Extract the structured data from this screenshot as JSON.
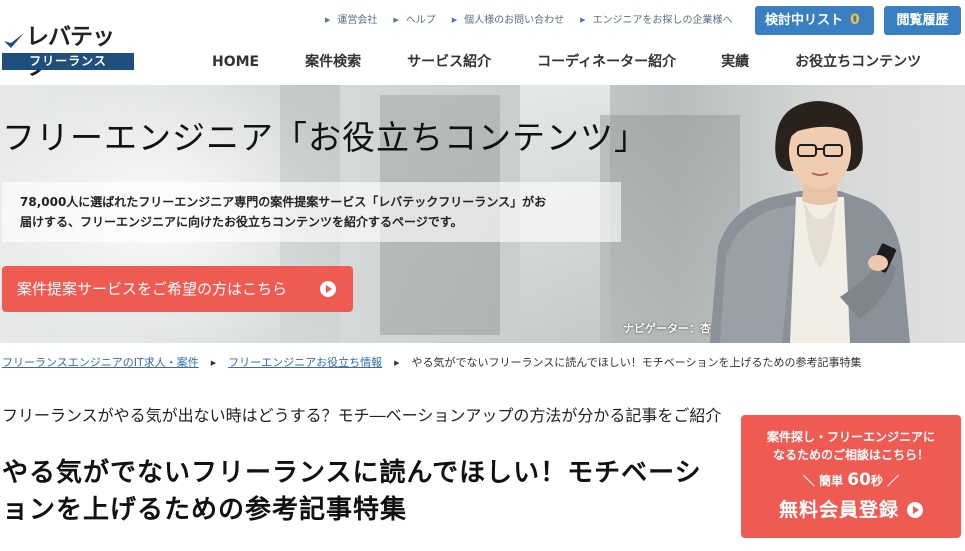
{
  "logo": {
    "main": "レバテック",
    "sub": "フリーランス"
  },
  "util_links": [
    "運営会社",
    "ヘルプ",
    "個人様のお問い合わせ",
    "エンジニアをお探しの企業様へ"
  ],
  "header_buttons": {
    "list_label": "検討中リスト",
    "list_count": "0",
    "history_label": "閲覧履歴"
  },
  "gnav": [
    "HOME",
    "案件検索",
    "サービス紹介",
    "コーディネーター紹介",
    "実績",
    "お役立ちコンテンツ"
  ],
  "hero": {
    "title": "フリーエンジニア「お役立ちコンテンツ」",
    "desc_line1": "78,000人に選ばれたフリーエンジニア専門の案件提案サービス「レバテックフリーランス」がお",
    "desc_line2": "届けする、フリーエンジニアに向けたお役立ちコンテンツを紹介するページです。",
    "cta": "案件提案サービスをご希望の方はこちら",
    "navigator": "ナビゲーター：杏"
  },
  "breadcrumb": {
    "items": [
      "フリーランスエンジニアのIT求人・案件",
      "フリーエンジニアお役立ち情報"
    ],
    "current": "やる気がでないフリーランスに読んでほしい！モチベーションを上げるための参考記事特集"
  },
  "article": {
    "lead": "フリーランスがやる気が出ない時はどうする？モチ―ベーションアップの方法が分かる記事をご紹介",
    "title": "やる気がでないフリーランスに読んでほしい！モチベーションを上げるための参考記事特集"
  },
  "side_cta": {
    "line1": "案件探し・フリーエンジニアに",
    "line2": "なるためのご相談はこちら！",
    "quick_prefix": "＼ 簡単",
    "quick_num": "60",
    "quick_suffix": "秒 ／",
    "register": "無料会員登録"
  },
  "colors": {
    "brand_blue": "#3a7fc1",
    "cta_red": "#ef5b53",
    "logo_navy": "#1e4f7d",
    "count_yellow": "#f6c237"
  }
}
